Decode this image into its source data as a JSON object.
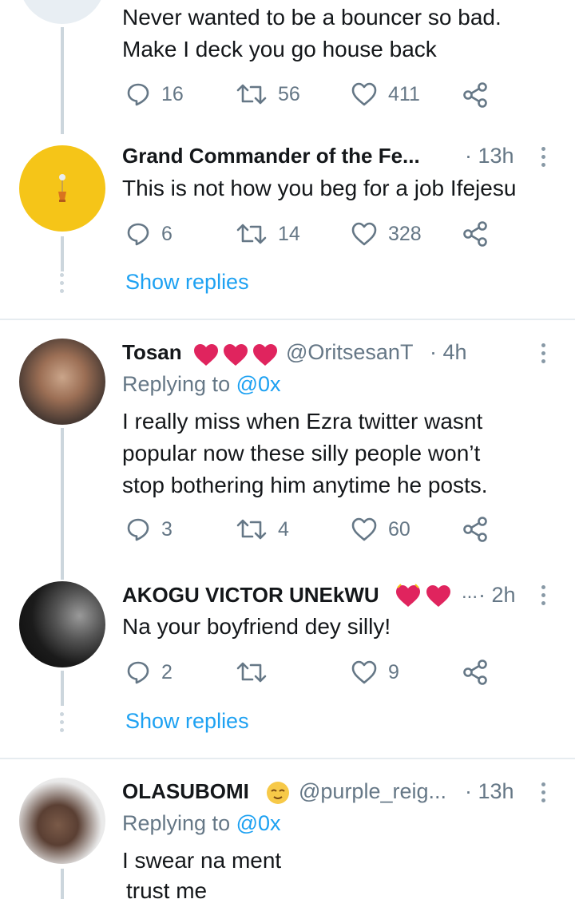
{
  "tweet0": {
    "text_line1": "Never wanted to be a bouncer so bad.",
    "text_line2": "Make I deck you go house back",
    "replies": "16",
    "retweets": "56",
    "likes": "411"
  },
  "tweet1": {
    "name": "Grand Commander of the Fe...",
    "time": "· 13h",
    "text": "This is not how you beg for a job Ifejesu",
    "replies": "6",
    "retweets": "14",
    "likes": "328",
    "show_replies": "Show replies"
  },
  "tweet2": {
    "name": "Tosan",
    "handle": "@OritsesanT",
    "time": "· 4h",
    "replying_prefix": "Replying to",
    "replying_to": "@0x",
    "text_line1": "I really miss when Ezra twitter wasnt",
    "text_line2": "popular now these silly people won’t",
    "text_line3": "stop bothering him anytime he posts.",
    "replies": "3",
    "retweets": "4",
    "likes": "60"
  },
  "tweet3": {
    "name": "AKOGU VICTOR UNEkWU",
    "ellipsis": "...",
    "time": "· 2h",
    "text": "Na your boyfriend dey silly!",
    "replies": "2",
    "retweets": "",
    "likes": "9",
    "show_replies": "Show replies"
  },
  "tweet4": {
    "name": "OLASUBOMI",
    "handle": "@purple_reig...",
    "time": "· 13h",
    "replying_prefix": "Replying to",
    "replying_to": "@0x",
    "text_line1": "I swear na ment",
    "text_line2": "trust me"
  },
  "colors": {
    "accent": "#1da1f2",
    "muted": "#657786",
    "heart": "#e0245e",
    "thread": "#ccd6dd"
  },
  "icons": [
    "reply-icon",
    "retweet-icon",
    "like-icon",
    "share-icon",
    "more-options-icon"
  ]
}
